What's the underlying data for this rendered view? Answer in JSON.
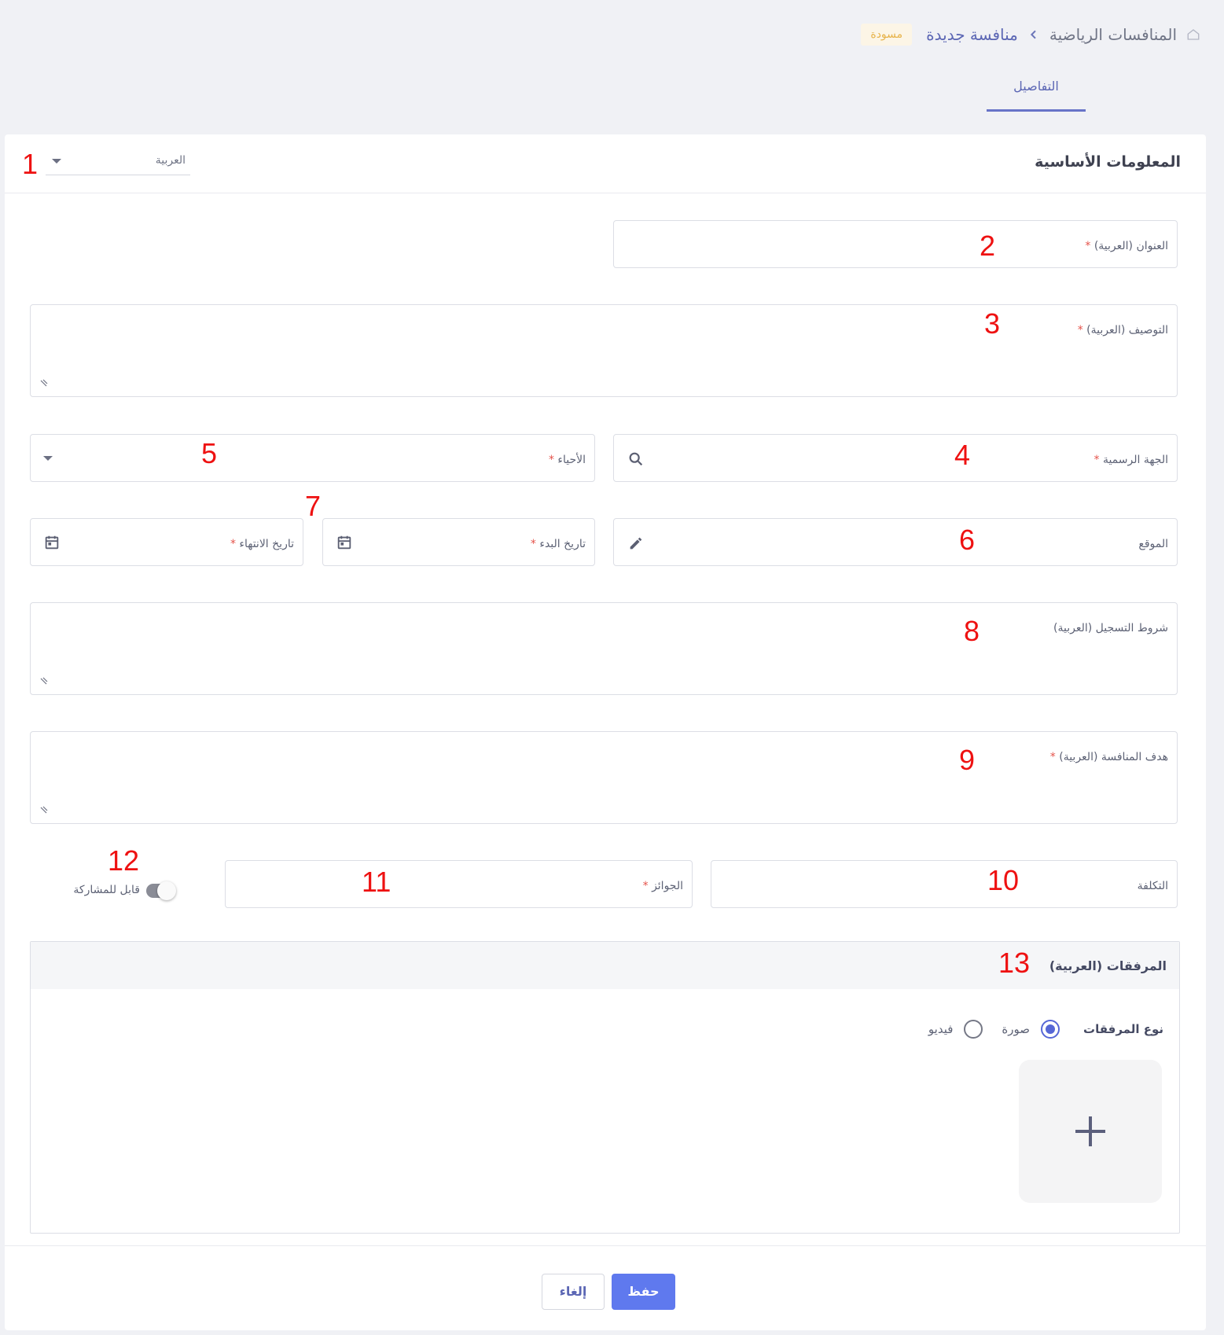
{
  "breadcrumb": {
    "root": "المنافسات الرياضية",
    "current": "منافسة جديدة",
    "status": "مسودة"
  },
  "tabs": [
    {
      "label": "التفاصيل",
      "active": true
    }
  ],
  "section": {
    "title": "المعلومات الأساسية",
    "language": "العربية"
  },
  "fields": {
    "title_label": "العنوان (العربية)",
    "description_label": "التوصيف (العربية)",
    "authority_label": "الجهة الرسمية",
    "neighborhoods_label": "الأحياء",
    "location_label": "الموقع",
    "start_date_label": "تاريخ البدء",
    "end_date_label": "تاريخ الانتهاء",
    "registration_label": "شروط التسجيل (العربية)",
    "goal_label": "هدف المنافسة (العربية)",
    "cost_label": "التكلفة",
    "prizes_label": "الجوائز",
    "required_mark": "*"
  },
  "toggle": {
    "label": "قابل للمشاركة",
    "on": false
  },
  "attachments": {
    "title": "المرفقات (العربية)",
    "type_label": "نوع المرفقات",
    "options": [
      "صورة",
      "فيديو"
    ],
    "selected": "صورة"
  },
  "actions": {
    "save": "حفظ",
    "cancel": "إلغاء"
  },
  "markers": [
    "1",
    "2",
    "3",
    "4",
    "5",
    "6",
    "7",
    "8",
    "9",
    "10",
    "11",
    "12",
    "13"
  ],
  "colors": {
    "accent": "#5f79ee",
    "marker": "#ee1111",
    "badge_text": "#e7b34a",
    "badge_bg": "#fcf5e6"
  }
}
